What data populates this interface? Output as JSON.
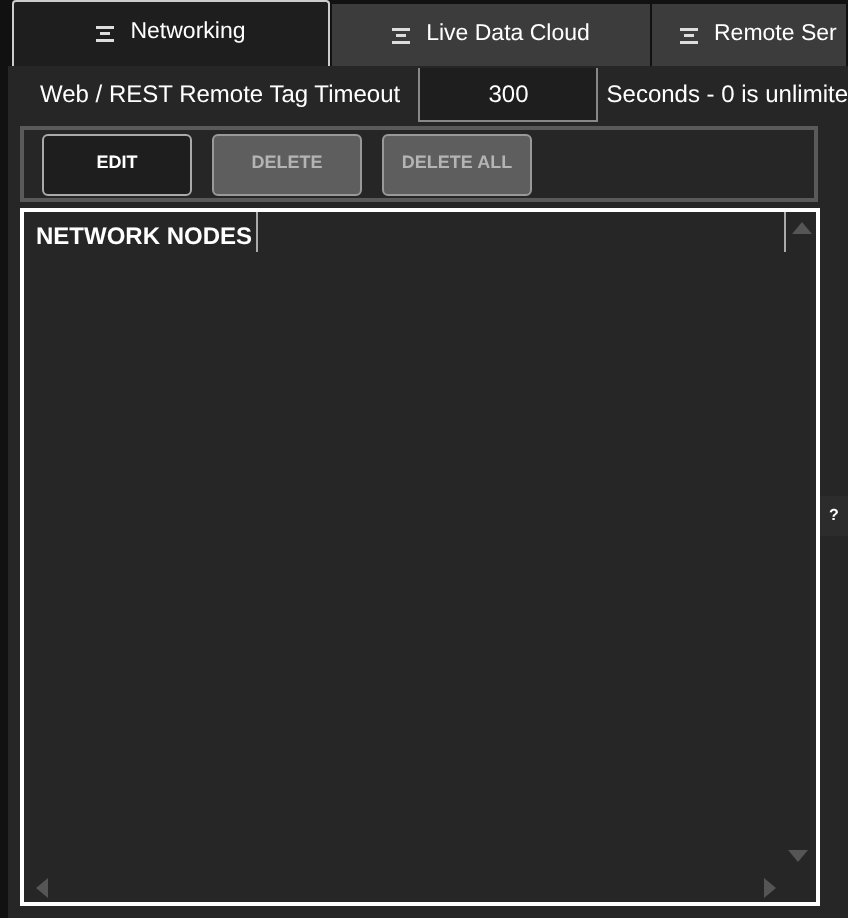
{
  "tabs": [
    {
      "label": "Networking",
      "selected": true
    },
    {
      "label": "Live Data Cloud",
      "selected": false
    },
    {
      "label": "Remote Ser",
      "selected": false
    }
  ],
  "timeout": {
    "label": "Web / REST Remote Tag Timeout",
    "value": "300",
    "note": "Seconds - 0 is unlimite"
  },
  "buttons": [
    {
      "label": "EDIT",
      "disabled": false
    },
    {
      "label": "DELETE",
      "disabled": true
    },
    {
      "label": "DELETE ALL",
      "disabled": true
    }
  ],
  "table": {
    "columns": [
      "NETWORK NODES"
    ]
  },
  "help": "?"
}
